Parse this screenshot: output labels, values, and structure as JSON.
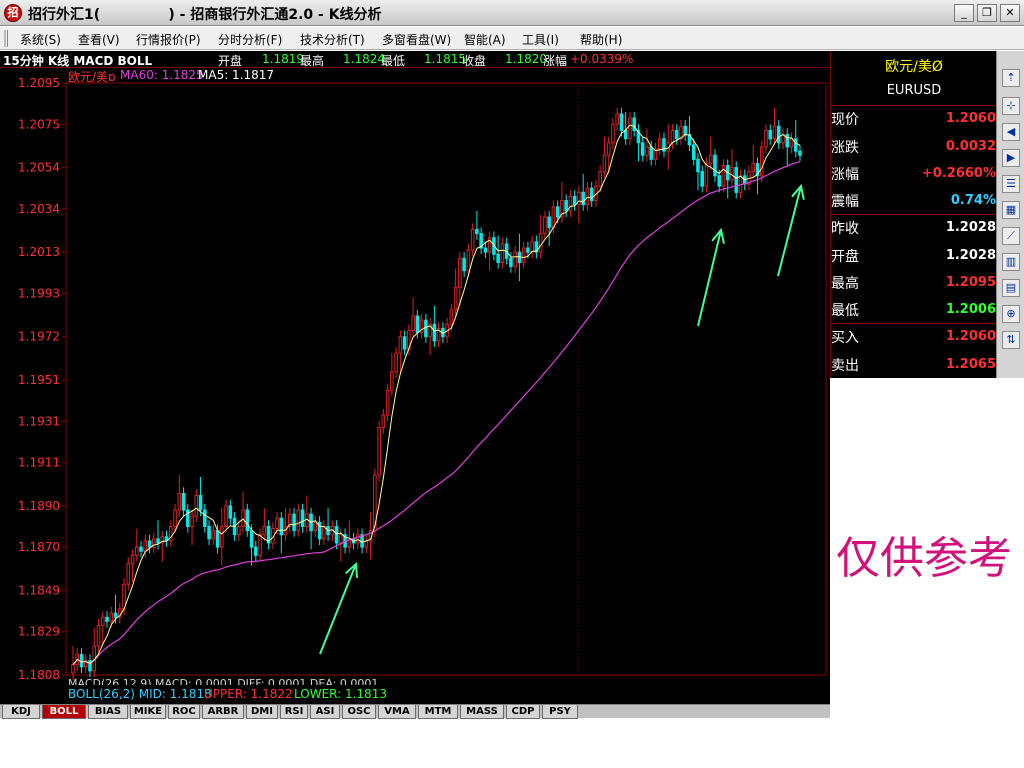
{
  "window": {
    "title": "招行外汇1(              ) - 招商银行外汇通2.0 - K线分析",
    "controls": {
      "minimize": "_",
      "restore": "❐",
      "close": "✕"
    }
  },
  "menu": [
    "系统(S)",
    "查看(V)",
    "行情报价(P)",
    "分时分析(F)",
    "技术分析(T)",
    "多窗看盘(W)",
    "智能(A)",
    "工具(I)",
    "帮助(H)"
  ],
  "chart_header": {
    "period": "15分钟 K线 MACD BOLL",
    "open_label": "开盘",
    "open_value": "1.1819",
    "high_label": "最高",
    "high_value": "1.1824",
    "low_label": "最低",
    "low_value": "1.1815",
    "close_label": "收盘",
    "close_value": "1.1820",
    "change_label": "涨幅",
    "change_value": "+0.0339%"
  },
  "ma_legend": {
    "pair": "欧元/美ɒ",
    "ma60": "MA60: 1.1825",
    "ma5": "MA5: 1.1817"
  },
  "indicator_legend": {
    "macd": "MACD(26,12,9) MACD: 0.0001  DIFF: 0.0001  DEA: 0.0001",
    "boll_mid": "BOLL(26,2) MID: 1.1818",
    "boll_upper": "UPPER: 1.1822",
    "boll_lower": "LOWER: 1.1813"
  },
  "tabs": [
    "KDJ",
    "BOLL",
    "BIAS",
    "MIKE",
    "ROC",
    "ARBR",
    "DMI",
    "RSI",
    "ASI",
    "OSC",
    "VMA",
    "MTM",
    "MASS",
    "CDP",
    "PSY"
  ],
  "active_tab": "BOLL",
  "quote": {
    "pair": "欧元/美Ø",
    "code": "EURUSD",
    "rows": [
      {
        "label": "现价",
        "value": "1.2060",
        "color": "#ff3030"
      },
      {
        "label": "涨跌",
        "value": "0.0032",
        "color": "#ff3030"
      },
      {
        "label": "涨幅",
        "value": "+0.2660%",
        "color": "#ff3030"
      },
      {
        "label": "震幅",
        "value": "0.74%",
        "color": "#30d0ff"
      },
      {
        "label": "昨收",
        "value": "1.2028",
        "color": "#ffffff"
      },
      {
        "label": "开盘",
        "value": "1.2028",
        "color": "#ffffff"
      },
      {
        "label": "最高",
        "value": "1.2095",
        "color": "#ff3030"
      },
      {
        "label": "最低",
        "value": "1.2006",
        "color": "#30ff30"
      },
      {
        "label": "买入",
        "value": "1.2060",
        "color": "#ff3030"
      },
      {
        "label": "卖出",
        "value": "1.2065",
        "color": "#ff3030"
      }
    ]
  },
  "toolbar_icons": [
    "scroll-up-icon",
    "cross-icon",
    "back-icon",
    "forward-icon",
    "list-icon",
    "table-icon",
    "chart-line-icon",
    "chart-bar-icon",
    "report-icon",
    "zoom-icon",
    "arrows-icon"
  ],
  "disclaimer": "仅供参考",
  "colors": {
    "up": "#e02020",
    "down": "#00e8e8",
    "ma5": "#ffffa0",
    "ma60": "#e040e0",
    "grid": "#8a0000",
    "arrow": "#40ff90"
  },
  "chart_data": {
    "type": "candlestick",
    "ylim": [
      1.1808,
      1.2095
    ],
    "y_ticks": [
      "1.2095",
      "1.2075",
      "1.2054",
      "1.2034",
      "1.2013",
      "1.1993",
      "1.1972",
      "1.1951",
      "1.1931",
      "1.1911",
      "1.1890",
      "1.1870",
      "1.1849",
      "1.1829",
      "1.1808"
    ],
    "closes": [
      1.1813,
      1.1818,
      1.1812,
      1.1815,
      1.181,
      1.1822,
      1.1832,
      1.1836,
      1.1834,
      1.1838,
      1.1836,
      1.184,
      1.1852,
      1.1862,
      1.1866,
      1.187,
      1.1868,
      1.1873,
      1.187,
      1.1874,
      1.1872,
      1.1875,
      1.1873,
      1.188,
      1.1888,
      1.1896,
      1.1888,
      1.188,
      1.1885,
      1.1895,
      1.1888,
      1.188,
      1.1874,
      1.1878,
      1.187,
      1.188,
      1.189,
      1.1884,
      1.1876,
      1.188,
      1.1888,
      1.1878,
      1.187,
      1.1866,
      1.1876,
      1.188,
      1.1872,
      1.1879,
      1.1884,
      1.1876,
      1.188,
      1.1886,
      1.1878,
      1.1888,
      1.188,
      1.1886,
      1.1878,
      1.1882,
      1.1874,
      1.188,
      1.1876,
      1.188,
      1.1872,
      1.1876,
      1.187,
      1.1874,
      1.1872,
      1.1876,
      1.187,
      1.1873,
      1.1878,
      1.1905,
      1.1928,
      1.1934,
      1.1946,
      1.1955,
      1.1964,
      1.1972,
      1.1966,
      1.1975,
      1.1982,
      1.1974,
      1.198,
      1.1972,
      1.1978,
      1.197,
      1.1976,
      1.1972,
      1.1978,
      1.1985,
      1.1996,
      1.201,
      1.2004,
      1.2014,
      1.2024,
      1.2022,
      1.2015,
      1.2013,
      1.202,
      1.2012,
      1.2008,
      1.2017,
      1.201,
      1.2006,
      1.2013,
      1.2008,
      1.2015,
      1.2013,
      1.2018,
      1.2013,
      1.2022,
      1.203,
      1.2025,
      1.2035,
      1.203,
      1.2038,
      1.2033,
      1.204,
      1.2036,
      1.2042,
      1.2036,
      1.2044,
      1.2038,
      1.2045,
      1.2052,
      1.206,
      1.2066,
      1.2075,
      1.208,
      1.2072,
      1.2068,
      1.2078,
      1.2072,
      1.2066,
      1.206,
      1.2064,
      1.2058,
      1.2063,
      1.2068,
      1.2062,
      1.2066,
      1.2072,
      1.2068,
      1.2074,
      1.207,
      1.2065,
      1.2058,
      1.2052,
      1.2045,
      1.2056,
      1.206,
      1.205,
      1.2045,
      1.2055,
      1.2048,
      1.2054,
      1.2042,
      1.205,
      1.2046,
      1.2052,
      1.2056,
      1.205,
      1.2064,
      1.2072,
      1.2068,
      1.2074,
      1.2066,
      1.207,
      1.2064,
      1.2068,
      1.2062,
      1.206
    ]
  }
}
